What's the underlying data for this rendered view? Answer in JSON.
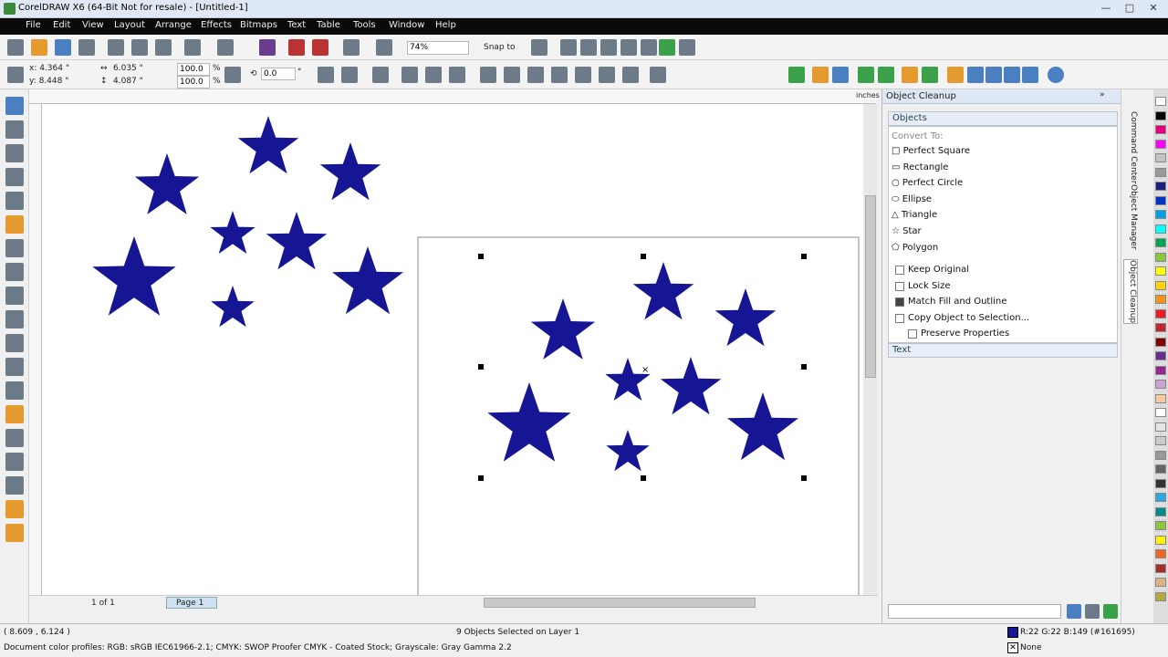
{
  "window": {
    "title": "CorelDRAW X6 (64-Bit Not for resale) - [Untitled-1]"
  },
  "menu": [
    "File",
    "Edit",
    "View",
    "Layout",
    "Arrange",
    "Effects",
    "Bitmaps",
    "Text",
    "Table",
    "Tools",
    "Window",
    "Help"
  ],
  "toolbar": {
    "zoom": "74%",
    "snap_to": "Snap to"
  },
  "props": {
    "x": "x: 4.364 \"",
    "y": "y: 8.448 \"",
    "w": "6.035 \"",
    "h": "4.087 \"",
    "sx": "100.0",
    "sy": "100.0",
    "pct": "%",
    "angle": "0.0",
    "deg": "°"
  },
  "ruler": {
    "unit": "inches"
  },
  "page_nav": {
    "count": "1 of 1",
    "tab": "Page 1"
  },
  "docker": {
    "title": "Object Cleanup",
    "objects_section": "Objects",
    "convert_to": "Convert To:",
    "shapes": [
      "Perfect Square",
      "Rectangle",
      "Perfect Circle",
      "Ellipse",
      "Triangle",
      "Star",
      "Polygon"
    ],
    "options": [
      {
        "label": "Keep Original",
        "checked": false
      },
      {
        "label": "Lock Size",
        "checked": false
      },
      {
        "label": "Match Fill and Outline",
        "checked": true
      },
      {
        "label": "Copy Object to Selection...",
        "checked": false
      },
      {
        "label": "Preserve Properties",
        "checked": false
      }
    ],
    "text_section": "Text"
  },
  "docker_tabs": [
    "Command Center",
    "Object Manager",
    "Object Cleanup"
  ],
  "status": {
    "coords": "( 8.609 , 6.124 )",
    "selection": "9 Objects Selected on Layer 1",
    "profiles": "Document color profiles: RGB: sRGB IEC61966-2.1; CMYK: SWOP Proofer CMYK - Coated Stock; Grayscale: Gray Gamma 2.2",
    "fill": "R:22 G:22 B:149 (#161695)",
    "outline": "None"
  },
  "colors": {
    "star": "#161695",
    "menubar": "#0a0a0a"
  }
}
